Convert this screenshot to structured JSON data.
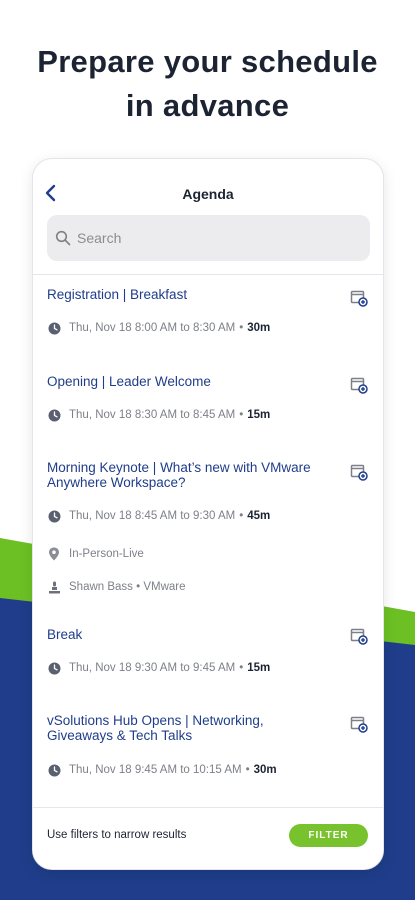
{
  "headline": {
    "line1": "Prepare your schedule",
    "line2": "in advance"
  },
  "screen": {
    "title": "Agenda",
    "search": {
      "placeholder": "Search",
      "value": ""
    },
    "sessions": [
      {
        "title": "Registration | Breakfast",
        "time": "Thu, Nov 18 8:00 AM to 8:30 AM",
        "duration": "30m"
      },
      {
        "title": "Opening | Leader Welcome",
        "time": "Thu, Nov 18 8:30 AM to 8:45 AM",
        "duration": "15m"
      },
      {
        "title": "Morning Keynote | What’s new with VMware Anywhere Workspace?",
        "time": "Thu, Nov 18 8:45 AM to 9:30 AM",
        "duration": "45m",
        "location": "In-Person-Live",
        "speaker": "Shawn Bass • VMware"
      },
      {
        "title": "Break",
        "time": "Thu, Nov 18 9:30 AM to 9:45 AM",
        "duration": "15m"
      },
      {
        "title": "vSolutions Hub Opens | Networking, Giveaways & Tech Talks",
        "time": "Thu, Nov 18 9:45 AM to 10:15 AM",
        "duration": "30m"
      }
    ],
    "footer": {
      "hint": "Use filters to narrow results",
      "filter_label": "FILTER"
    }
  },
  "icons": {
    "back": "chevron-left-icon",
    "search": "search-icon",
    "add_calendar": "calendar-add-icon",
    "clock": "clock-icon",
    "location": "location-pin-icon",
    "speaker": "speaker-icon"
  },
  "colors": {
    "accent_blue": "#1f3d8a",
    "accent_green": "#6cc024",
    "filter_button": "#78c32d"
  }
}
